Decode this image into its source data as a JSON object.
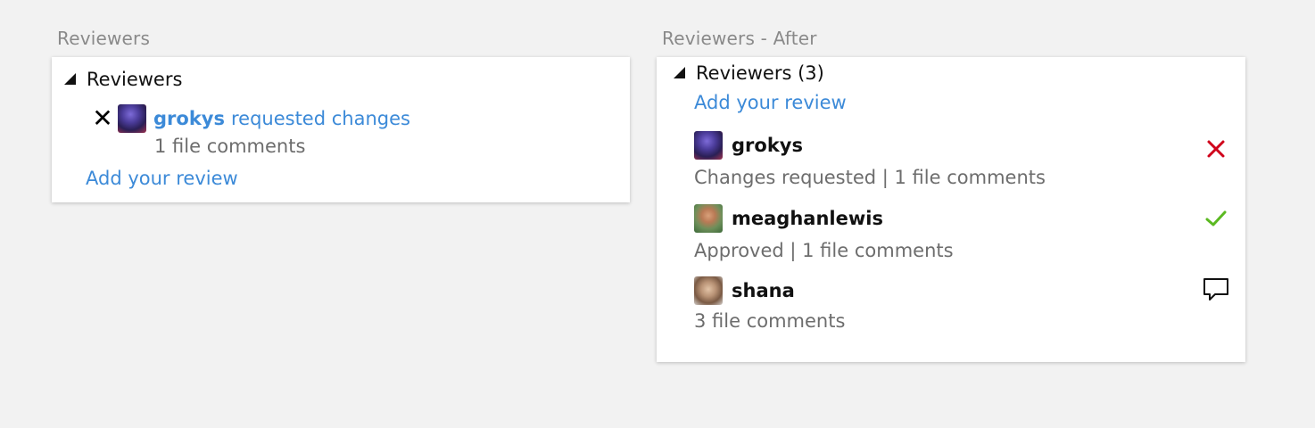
{
  "before": {
    "caption": "Reviewers",
    "section_title": "Reviewers",
    "reviewer": {
      "name": "grokys",
      "action": "requested changes",
      "comments": "1 file comments",
      "status_icon": "x-icon"
    },
    "add_review": "Add your review"
  },
  "after": {
    "caption": "Reviewers - After",
    "section_title": "Reviewers (3)",
    "add_review": "Add your review",
    "reviewers": [
      {
        "name": "grokys",
        "summary": "Changes requested | 1 file comments",
        "status_icon": "x-icon",
        "status_color": "#d0021b"
      },
      {
        "name": "meaghanlewis",
        "summary": "Approved | 1 file comments",
        "status_icon": "check-icon",
        "status_color": "#5bb921"
      },
      {
        "name": "shana",
        "summary": "3 file comments",
        "status_icon": "comment-icon",
        "status_color": "#111111"
      }
    ]
  },
  "colors": {
    "link": "#3c8ad8",
    "muted": "#6d6d6d",
    "background": "#f2f2f2"
  }
}
